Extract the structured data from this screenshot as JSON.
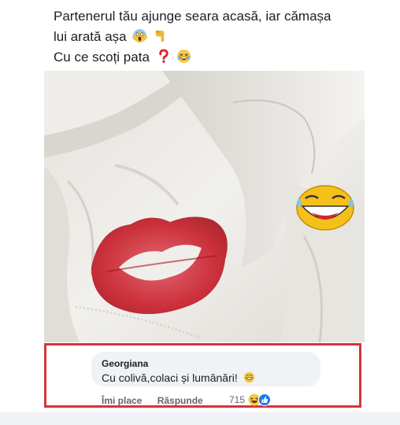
{
  "post": {
    "line1": "Partenerul tău ajunge seara acasă, iar cămașa",
    "line2": "lui arată așa",
    "line3": "Cu ce scoți pata",
    "emoji_line2": [
      "scream-emoji-icon",
      "pointing-down-emoji-icon"
    ],
    "emoji_line3": [
      "question-mark-emoji-icon",
      "laughing-emoji-icon"
    ]
  },
  "photo": {
    "subject": "white shirt with red lipstick kiss mark"
  },
  "comment": {
    "author": "Georgiana",
    "text": "Cu colivă,colaci și lumânări!",
    "like_label": "Îmi place",
    "reply_label": "Răspunde",
    "reaction_count": "715",
    "reaction_icons": [
      "haha-reaction-icon",
      "like-reaction-icon"
    ]
  },
  "colors": {
    "highlight_border": "#d6343a",
    "lipstick": "#c8202c",
    "like_blue": "#1877f2"
  }
}
